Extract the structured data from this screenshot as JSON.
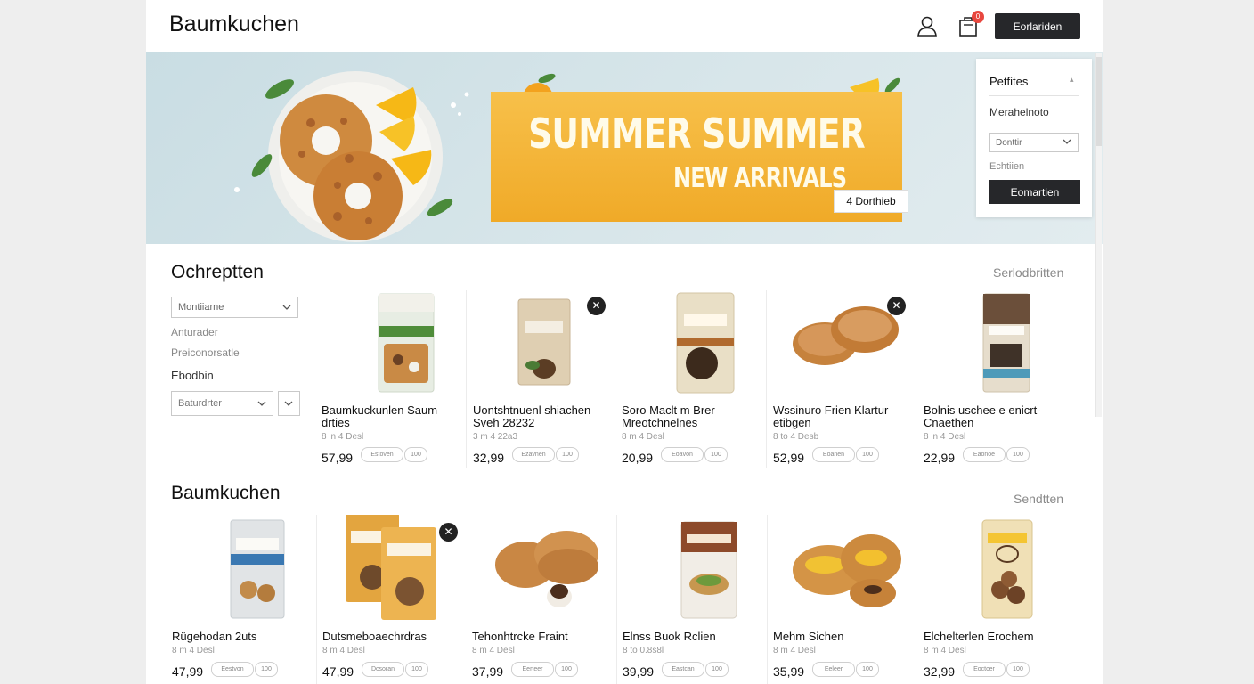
{
  "header": {
    "brand": "Baumkuchen",
    "cart_count": "0",
    "button_label": "Eorlariden",
    "icons": [
      "user-icon",
      "cart-icon"
    ]
  },
  "hero": {
    "line1": "SUMMER SUMMER",
    "line2": "NEW ARRIVALS",
    "tag": "4 Dorthieb"
  },
  "filter_panel": {
    "title": "Petfites",
    "subtitle": "Merahelnoto",
    "select_value": "Donttir",
    "secondary": "Echtiien",
    "button_label": "Eomartien"
  },
  "section1": {
    "title": "Ochreptten",
    "see_all": "Serlodbritten",
    "sidebar": {
      "select_value": "Montiiarne",
      "link1": "Anturader",
      "link2": "Preiconorsatle",
      "label": "Ebodbin",
      "select2_value": "Baturdrter"
    },
    "products": [
      {
        "name": "Baumkuckunlen Saum drties",
        "meta": "8 in 4 Desl",
        "price": "57,99",
        "chip1": "Estoven",
        "chip2": "100"
      },
      {
        "name": "Uontshtnuenl shiachen Sveh 28232",
        "meta": "3 m 4 22a3",
        "price": "32,99",
        "chip1": "Ezavnen",
        "chip2": "100"
      },
      {
        "name": "Soro Maclt m Brer Mreotchnelnes",
        "meta": "8 m 4 Desl",
        "price": "20,99",
        "chip1": "Eoavon",
        "chip2": "100"
      },
      {
        "name": "Wssinuro Frien Klartur etibgen",
        "meta": "8 to 4 Desb",
        "price": "52,99",
        "chip1": "Eoanen",
        "chip2": "100"
      },
      {
        "name": "Bolnis uschee e enicrt-Cnaethen",
        "meta": "8 in 4 Desl",
        "price": "22,99",
        "chip1": "Eaonoe",
        "chip2": "100"
      }
    ]
  },
  "section2": {
    "title": "Baumkuchen",
    "see_all": "Sendtten",
    "products": [
      {
        "name": "Rügehodan 2uts",
        "meta": "8 m 4 Desl",
        "price": "47,99",
        "chip1": "Eestvon",
        "chip2": "100"
      },
      {
        "name": "Dutsmeboaechrdras",
        "meta": "8 m 4 Desl",
        "price": "47,99",
        "chip1": "Dcsoran",
        "chip2": "100"
      },
      {
        "name": "Tehonhtrcke Fraint",
        "meta": "8 m 4 Desl",
        "price": "37,99",
        "chip1": "Eerteer",
        "chip2": "100"
      },
      {
        "name": "Elnss Buok Rclien",
        "meta": "8 to 0.8s8l",
        "price": "39,99",
        "chip1": "Eastcan",
        "chip2": "100"
      },
      {
        "name": "Mehm Sichen",
        "meta": "8 m 4 Desl",
        "price": "35,99",
        "chip1": "Eeleer",
        "chip2": "100"
      },
      {
        "name": "Elchelterlen Erochem",
        "meta": "8 m 4 Desl",
        "price": "32,99",
        "chip1": "Eoctcer",
        "chip2": "100"
      }
    ]
  }
}
